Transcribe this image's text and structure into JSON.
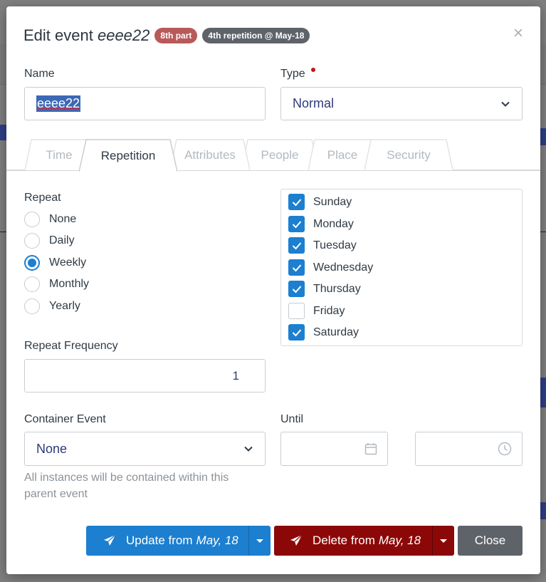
{
  "modal": {
    "title_prefix": "Edit event",
    "event_name": "eeee22",
    "badge_part": "8th part",
    "badge_repetition": "4th repetition @ May-18",
    "close_symbol": "×"
  },
  "form": {
    "name_label": "Name",
    "name_value": "eeee22",
    "type_label": "Type",
    "type_value": "Normal"
  },
  "tabs": [
    {
      "label": "Time",
      "active": false
    },
    {
      "label": "Repetition",
      "active": true
    },
    {
      "label": "Attributes",
      "active": false
    },
    {
      "label": "People",
      "active": false
    },
    {
      "label": "Place",
      "active": false
    },
    {
      "label": "Security",
      "active": false
    }
  ],
  "repeat": {
    "label": "Repeat",
    "options": [
      "None",
      "Daily",
      "Weekly",
      "Monthly",
      "Yearly"
    ],
    "selected": "Weekly"
  },
  "days": [
    {
      "label": "Sunday",
      "checked": true
    },
    {
      "label": "Monday",
      "checked": true
    },
    {
      "label": "Tuesday",
      "checked": true
    },
    {
      "label": "Wednesday",
      "checked": true
    },
    {
      "label": "Thursday",
      "checked": true
    },
    {
      "label": "Friday",
      "checked": false
    },
    {
      "label": "Saturday",
      "checked": true
    }
  ],
  "frequency": {
    "label": "Repeat Frequency",
    "value": "1"
  },
  "container": {
    "label": "Container Event",
    "value": "None",
    "help": "All instances will be contained within this parent event"
  },
  "until": {
    "label": "Until",
    "date_icon": "calendar-icon",
    "time_icon": "clock-icon"
  },
  "buttons": {
    "update_label": "Update from",
    "update_date": "May, 18",
    "delete_label": "Delete from",
    "delete_date": "May, 18",
    "close_label": "Close"
  },
  "colors": {
    "primary": "#1c7fcf",
    "danger": "#8c0808",
    "secondary": "#5e6369",
    "badge_part": "#b85a59"
  }
}
